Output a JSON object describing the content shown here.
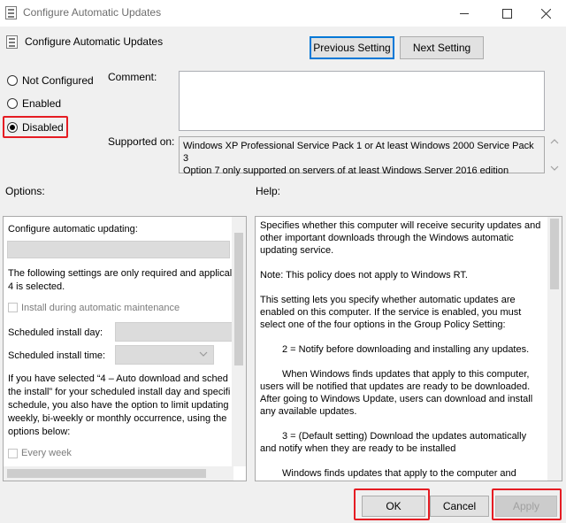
{
  "window": {
    "title": "Configure Automatic Updates",
    "controls": [
      "minimize",
      "maximize",
      "close"
    ]
  },
  "header": {
    "policy_name": "Configure Automatic Updates",
    "prev_button": "Previous Setting",
    "next_button": "Next Setting"
  },
  "state": {
    "options": [
      {
        "label": "Not Configured",
        "checked": false
      },
      {
        "label": "Enabled",
        "checked": false
      },
      {
        "label": "Disabled",
        "checked": true
      }
    ]
  },
  "comment": {
    "label": "Comment:",
    "value": ""
  },
  "supported": {
    "label": "Supported on:",
    "lines": [
      "Windows XP Professional Service Pack 1 or At least Windows 2000 Service Pack 3",
      "Option 7 only supported on servers of at least Windows Server 2016 edition"
    ]
  },
  "options_section": {
    "label": "Options:",
    "configure_label": "Configure automatic updating:",
    "note_lines": [
      "The following settings are only required and applical",
      "4 is selected."
    ],
    "install_maintenance": "Install during automatic maintenance",
    "install_day_label": "Scheduled install day:",
    "install_time_label": "Scheduled install time:",
    "schedule_note_lines": [
      "If you have selected “4 – Auto download and sched",
      "the install” for your scheduled install day and specifi",
      "schedule, you also have the option to limit updating",
      "weekly, bi-weekly or monthly occurrence, using the",
      "options below:"
    ],
    "every_week": "Every week"
  },
  "help_section": {
    "label": "Help:",
    "paragraphs": [
      "Specifies whether this computer will receive security updates and other important downloads through the Windows automatic updating service.",
      "Note: This policy does not apply to Windows RT.",
      "This setting lets you specify whether automatic updates are enabled on this computer. If the service is enabled, you must select one of the four options in the Group Policy Setting:",
      "2 = Notify before downloading and installing any updates.",
      "When Windows finds updates that apply to this computer, users will be notified that updates are ready to be downloaded. After going to Windows Update, users can download and install any available updates.",
      "3 = (Default setting) Download the updates automatically and notify when they are ready to be installed",
      "Windows finds updates that apply to the computer and downloads them in the background"
    ]
  },
  "footer": {
    "ok": "OK",
    "cancel": "Cancel",
    "apply": "Apply"
  }
}
